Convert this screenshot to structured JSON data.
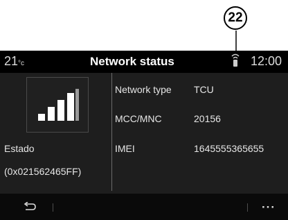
{
  "callout": {
    "number": "22"
  },
  "topbar": {
    "temperature": "21",
    "temperature_unit": "°c",
    "title": "Network status",
    "time": "12:00",
    "signal_icon": "network-signal-icon"
  },
  "left_panel": {
    "signal_strength_icon": "signal-bars-icon",
    "signal_bars_filled": 4,
    "status_label": "Estado",
    "status_code": "(0x021562465FF)"
  },
  "info_rows": [
    {
      "label": "Network type",
      "value": "TCU"
    },
    {
      "label": "MCC/MNC",
      "value": "20156"
    },
    {
      "label": "IMEI",
      "value": "1645555365655"
    }
  ],
  "bottombar": {
    "back_icon": "back-arrow-icon",
    "more_label": "···"
  },
  "colors": {
    "background": "#1e1e1e",
    "topbar": "#000000",
    "text": "#e6e6e6"
  }
}
